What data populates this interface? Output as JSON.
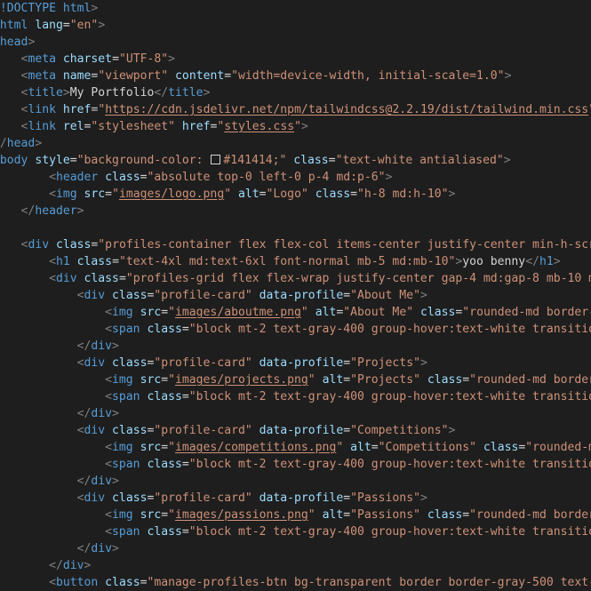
{
  "theme": {
    "background": "#1e1e1e",
    "punctuation": "#808080",
    "tag": "#569cd6",
    "attribute": "#9cdcfe",
    "string": "#ce9178",
    "text": "#d4d4d4"
  },
  "editor": {
    "lines": [
      [
        [
          "p",
          "<"
        ],
        [
          "k",
          "!DOCTYPE html"
        ],
        [
          "p",
          ">"
        ]
      ],
      [
        [
          "p",
          "<"
        ],
        [
          "k",
          "html"
        ],
        [
          "x",
          " "
        ],
        [
          "a",
          "lang"
        ],
        [
          "x",
          "="
        ],
        [
          "s",
          "\"en\""
        ],
        [
          "p",
          ">"
        ]
      ],
      [
        [
          "p",
          "<"
        ],
        [
          "k",
          "head"
        ],
        [
          "p",
          ">"
        ]
      ],
      [
        [
          "x",
          "    "
        ],
        [
          "p",
          "<"
        ],
        [
          "k",
          "meta"
        ],
        [
          "x",
          " "
        ],
        [
          "a",
          "charset"
        ],
        [
          "x",
          "="
        ],
        [
          "s",
          "\"UTF-8\""
        ],
        [
          "p",
          ">"
        ]
      ],
      [
        [
          "x",
          "    "
        ],
        [
          "p",
          "<"
        ],
        [
          "k",
          "meta"
        ],
        [
          "x",
          " "
        ],
        [
          "a",
          "name"
        ],
        [
          "x",
          "="
        ],
        [
          "s",
          "\"viewport\""
        ],
        [
          "x",
          " "
        ],
        [
          "a",
          "content"
        ],
        [
          "x",
          "="
        ],
        [
          "s",
          "\"width=device-width, initial-scale=1.0\""
        ],
        [
          "p",
          ">"
        ]
      ],
      [
        [
          "x",
          "    "
        ],
        [
          "p",
          "<"
        ],
        [
          "k",
          "title"
        ],
        [
          "p",
          ">"
        ],
        [
          "x",
          "My Portfolio"
        ],
        [
          "p",
          "</"
        ],
        [
          "k",
          "title"
        ],
        [
          "p",
          ">"
        ]
      ],
      [
        [
          "x",
          "    "
        ],
        [
          "p",
          "<"
        ],
        [
          "k",
          "link"
        ],
        [
          "x",
          " "
        ],
        [
          "a",
          "href"
        ],
        [
          "x",
          "="
        ],
        [
          "s",
          "\""
        ],
        [
          "u",
          "https://cdn.jsdelivr.net/npm/tailwindcss@2.2.19/dist/tailwind.min.css"
        ],
        [
          "s",
          "\""
        ],
        [
          "x",
          " "
        ],
        [
          "a",
          "rel"
        ],
        [
          "x",
          "="
        ],
        [
          "s",
          "\"stylesheet\""
        ],
        [
          "p",
          ">"
        ]
      ],
      [
        [
          "x",
          "    "
        ],
        [
          "p",
          "<"
        ],
        [
          "k",
          "link"
        ],
        [
          "x",
          " "
        ],
        [
          "a",
          "rel"
        ],
        [
          "x",
          "="
        ],
        [
          "s",
          "\"stylesheet\""
        ],
        [
          "x",
          " "
        ],
        [
          "a",
          "href"
        ],
        [
          "x",
          "="
        ],
        [
          "s",
          "\""
        ],
        [
          "u",
          "styles.css"
        ],
        [
          "s",
          "\""
        ],
        [
          "p",
          ">"
        ]
      ],
      [
        [
          "p",
          "</"
        ],
        [
          "k",
          "head"
        ],
        [
          "p",
          ">"
        ]
      ],
      [
        [
          "p",
          "<"
        ],
        [
          "k",
          "body"
        ],
        [
          "x",
          " "
        ],
        [
          "a",
          "style"
        ],
        [
          "x",
          "="
        ],
        [
          "s",
          "\"background-color: "
        ],
        [
          "w",
          ""
        ],
        [
          "s",
          "#141414;\""
        ],
        [
          "x",
          " "
        ],
        [
          "a",
          "class"
        ],
        [
          "x",
          "="
        ],
        [
          "s",
          "\"text-white antialiased\""
        ],
        [
          "p",
          ">"
        ]
      ],
      [
        [
          "x",
          "        "
        ],
        [
          "p",
          "<"
        ],
        [
          "k",
          "header"
        ],
        [
          "x",
          " "
        ],
        [
          "a",
          "class"
        ],
        [
          "x",
          "="
        ],
        [
          "s",
          "\"absolute top-0 left-0 p-4 md:p-6\""
        ],
        [
          "p",
          ">"
        ]
      ],
      [
        [
          "x",
          "        "
        ],
        [
          "p",
          "<"
        ],
        [
          "k",
          "img"
        ],
        [
          "x",
          " "
        ],
        [
          "a",
          "src"
        ],
        [
          "x",
          "="
        ],
        [
          "s",
          "\""
        ],
        [
          "u",
          "images/logo.png"
        ],
        [
          "s",
          "\""
        ],
        [
          "x",
          " "
        ],
        [
          "a",
          "alt"
        ],
        [
          "x",
          "="
        ],
        [
          "s",
          "\"Logo\""
        ],
        [
          "x",
          " "
        ],
        [
          "a",
          "class"
        ],
        [
          "x",
          "="
        ],
        [
          "s",
          "\"h-8 md:h-10\""
        ],
        [
          "p",
          ">"
        ]
      ],
      [
        [
          "x",
          "    "
        ],
        [
          "p",
          "</"
        ],
        [
          "k",
          "header"
        ],
        [
          "p",
          ">"
        ]
      ],
      [],
      [
        [
          "x",
          "    "
        ],
        [
          "p",
          "<"
        ],
        [
          "k",
          "div"
        ],
        [
          "x",
          " "
        ],
        [
          "a",
          "class"
        ],
        [
          "x",
          "="
        ],
        [
          "s",
          "\"profiles-container flex flex-col items-center justify-center min-h-screen\""
        ],
        [
          "p",
          ">"
        ]
      ],
      [
        [
          "x",
          "        "
        ],
        [
          "p",
          "<"
        ],
        [
          "k",
          "h1"
        ],
        [
          "x",
          " "
        ],
        [
          "a",
          "class"
        ],
        [
          "x",
          "="
        ],
        [
          "s",
          "\"text-4xl md:text-6xl font-normal mb-5 md:mb-10\""
        ],
        [
          "p",
          ">"
        ],
        [
          "x",
          "yoo benny"
        ],
        [
          "p",
          "</"
        ],
        [
          "k",
          "h1"
        ],
        [
          "p",
          ">"
        ]
      ],
      [
        [
          "x",
          "        "
        ],
        [
          "p",
          "<"
        ],
        [
          "k",
          "div"
        ],
        [
          "x",
          " "
        ],
        [
          "a",
          "class"
        ],
        [
          "x",
          "="
        ],
        [
          "s",
          "\"profiles-grid flex flex-wrap justify-center gap-4 md:gap-8 mb-10 md:mb-20\""
        ],
        [
          "p",
          ">"
        ]
      ],
      [
        [
          "x",
          "            "
        ],
        [
          "p",
          "<"
        ],
        [
          "k",
          "div"
        ],
        [
          "x",
          " "
        ],
        [
          "a",
          "class"
        ],
        [
          "x",
          "="
        ],
        [
          "s",
          "\"profile-card\""
        ],
        [
          "x",
          " "
        ],
        [
          "a",
          "data-profile"
        ],
        [
          "x",
          "="
        ],
        [
          "s",
          "\"About Me\""
        ],
        [
          "p",
          ">"
        ]
      ],
      [
        [
          "x",
          "                "
        ],
        [
          "p",
          "<"
        ],
        [
          "k",
          "img"
        ],
        [
          "x",
          " "
        ],
        [
          "a",
          "src"
        ],
        [
          "x",
          "="
        ],
        [
          "s",
          "\""
        ],
        [
          "u",
          "images/aboutme.png"
        ],
        [
          "s",
          "\""
        ],
        [
          "x",
          " "
        ],
        [
          "a",
          "alt"
        ],
        [
          "x",
          "="
        ],
        [
          "s",
          "\"About Me\""
        ],
        [
          "x",
          " "
        ],
        [
          "a",
          "class"
        ],
        [
          "x",
          "="
        ],
        [
          "s",
          "\"rounded-md border-2\""
        ],
        [
          "p",
          ">"
        ]
      ],
      [
        [
          "x",
          "                "
        ],
        [
          "p",
          "<"
        ],
        [
          "k",
          "span"
        ],
        [
          "x",
          " "
        ],
        [
          "a",
          "class"
        ],
        [
          "x",
          "="
        ],
        [
          "s",
          "\"block mt-2 text-gray-400 group-hover:text-white transition\""
        ],
        [
          "p",
          ">"
        ]
      ],
      [
        [
          "x",
          "            "
        ],
        [
          "p",
          "</"
        ],
        [
          "k",
          "div"
        ],
        [
          "p",
          ">"
        ]
      ],
      [
        [
          "x",
          "            "
        ],
        [
          "p",
          "<"
        ],
        [
          "k",
          "div"
        ],
        [
          "x",
          " "
        ],
        [
          "a",
          "class"
        ],
        [
          "x",
          "="
        ],
        [
          "s",
          "\"profile-card\""
        ],
        [
          "x",
          " "
        ],
        [
          "a",
          "data-profile"
        ],
        [
          "x",
          "="
        ],
        [
          "s",
          "\"Projects\""
        ],
        [
          "p",
          ">"
        ]
      ],
      [
        [
          "x",
          "                "
        ],
        [
          "p",
          "<"
        ],
        [
          "k",
          "img"
        ],
        [
          "x",
          " "
        ],
        [
          "a",
          "src"
        ],
        [
          "x",
          "="
        ],
        [
          "s",
          "\""
        ],
        [
          "u",
          "images/projects.png"
        ],
        [
          "s",
          "\""
        ],
        [
          "x",
          " "
        ],
        [
          "a",
          "alt"
        ],
        [
          "x",
          "="
        ],
        [
          "s",
          "\"Projects\""
        ],
        [
          "x",
          " "
        ],
        [
          "a",
          "class"
        ],
        [
          "x",
          "="
        ],
        [
          "s",
          "\"rounded-md border-2\""
        ],
        [
          "p",
          ">"
        ]
      ],
      [
        [
          "x",
          "                "
        ],
        [
          "p",
          "<"
        ],
        [
          "k",
          "span"
        ],
        [
          "x",
          " "
        ],
        [
          "a",
          "class"
        ],
        [
          "x",
          "="
        ],
        [
          "s",
          "\"block mt-2 text-gray-400 group-hover:text-white transition\""
        ],
        [
          "p",
          ">"
        ]
      ],
      [
        [
          "x",
          "            "
        ],
        [
          "p",
          "</"
        ],
        [
          "k",
          "div"
        ],
        [
          "p",
          ">"
        ]
      ],
      [
        [
          "x",
          "            "
        ],
        [
          "p",
          "<"
        ],
        [
          "k",
          "div"
        ],
        [
          "x",
          " "
        ],
        [
          "a",
          "class"
        ],
        [
          "x",
          "="
        ],
        [
          "s",
          "\"profile-card\""
        ],
        [
          "x",
          " "
        ],
        [
          "a",
          "data-profile"
        ],
        [
          "x",
          "="
        ],
        [
          "s",
          "\"Competitions\""
        ],
        [
          "p",
          ">"
        ]
      ],
      [
        [
          "x",
          "                "
        ],
        [
          "p",
          "<"
        ],
        [
          "k",
          "img"
        ],
        [
          "x",
          " "
        ],
        [
          "a",
          "src"
        ],
        [
          "x",
          "="
        ],
        [
          "s",
          "\""
        ],
        [
          "u",
          "images/competitions.png"
        ],
        [
          "s",
          "\""
        ],
        [
          "x",
          " "
        ],
        [
          "a",
          "alt"
        ],
        [
          "x",
          "="
        ],
        [
          "s",
          "\"Competitions\""
        ],
        [
          "x",
          " "
        ],
        [
          "a",
          "class"
        ],
        [
          "x",
          "="
        ],
        [
          "s",
          "\"rounded-md border-2\""
        ],
        [
          "p",
          ">"
        ]
      ],
      [
        [
          "x",
          "                "
        ],
        [
          "p",
          "<"
        ],
        [
          "k",
          "span"
        ],
        [
          "x",
          " "
        ],
        [
          "a",
          "class"
        ],
        [
          "x",
          "="
        ],
        [
          "s",
          "\"block mt-2 text-gray-400 group-hover:text-white transition\""
        ],
        [
          "p",
          ">"
        ]
      ],
      [
        [
          "x",
          "            "
        ],
        [
          "p",
          "</"
        ],
        [
          "k",
          "div"
        ],
        [
          "p",
          ">"
        ]
      ],
      [
        [
          "x",
          "            "
        ],
        [
          "p",
          "<"
        ],
        [
          "k",
          "div"
        ],
        [
          "x",
          " "
        ],
        [
          "a",
          "class"
        ],
        [
          "x",
          "="
        ],
        [
          "s",
          "\"profile-card\""
        ],
        [
          "x",
          " "
        ],
        [
          "a",
          "data-profile"
        ],
        [
          "x",
          "="
        ],
        [
          "s",
          "\"Passions\""
        ],
        [
          "p",
          ">"
        ]
      ],
      [
        [
          "x",
          "                "
        ],
        [
          "p",
          "<"
        ],
        [
          "k",
          "img"
        ],
        [
          "x",
          " "
        ],
        [
          "a",
          "src"
        ],
        [
          "x",
          "="
        ],
        [
          "s",
          "\""
        ],
        [
          "u",
          "images/passions.png"
        ],
        [
          "s",
          "\""
        ],
        [
          "x",
          " "
        ],
        [
          "a",
          "alt"
        ],
        [
          "x",
          "="
        ],
        [
          "s",
          "\"Passions\""
        ],
        [
          "x",
          " "
        ],
        [
          "a",
          "class"
        ],
        [
          "x",
          "="
        ],
        [
          "s",
          "\"rounded-md border-2\""
        ],
        [
          "p",
          ">"
        ]
      ],
      [
        [
          "x",
          "                "
        ],
        [
          "p",
          "<"
        ],
        [
          "k",
          "span"
        ],
        [
          "x",
          " "
        ],
        [
          "a",
          "class"
        ],
        [
          "x",
          "="
        ],
        [
          "s",
          "\"block mt-2 text-gray-400 group-hover:text-white transition\""
        ],
        [
          "p",
          ">"
        ]
      ],
      [
        [
          "x",
          "            "
        ],
        [
          "p",
          "</"
        ],
        [
          "k",
          "div"
        ],
        [
          "p",
          ">"
        ]
      ],
      [
        [
          "x",
          "        "
        ],
        [
          "p",
          "</"
        ],
        [
          "k",
          "div"
        ],
        [
          "p",
          ">"
        ]
      ],
      [
        [
          "x",
          "        "
        ],
        [
          "p",
          "<"
        ],
        [
          "k",
          "button"
        ],
        [
          "x",
          " "
        ],
        [
          "a",
          "class"
        ],
        [
          "x",
          "="
        ],
        [
          "s",
          "\"manage-profiles-btn bg-transparent border border-gray-500 text-gray-500\""
        ],
        [
          "p",
          ">"
        ]
      ]
    ]
  }
}
